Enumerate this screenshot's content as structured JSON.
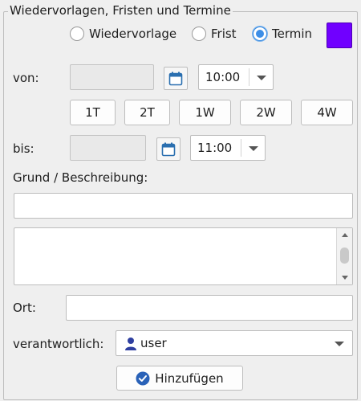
{
  "group": {
    "title": "Wiedervorlagen, Fristen und Termine"
  },
  "type_options": [
    {
      "label": "Wiedervorlage",
      "checked": false
    },
    {
      "label": "Frist",
      "checked": false
    },
    {
      "label": "Termin",
      "checked": true
    }
  ],
  "color": "#7000ff",
  "von": {
    "label": "von:",
    "date": "",
    "time": "10:00"
  },
  "quick_buttons": [
    "1T",
    "2T",
    "1W",
    "2W",
    "4W"
  ],
  "bis": {
    "label": "bis:",
    "date": "",
    "time": "11:00"
  },
  "reason": {
    "label": "Grund / Beschreibung:",
    "value": "",
    "description": ""
  },
  "ort": {
    "label": "Ort:",
    "value": ""
  },
  "responsible": {
    "label": "verantwortlich:",
    "value": "user"
  },
  "add_button": {
    "label": "Hinzufügen"
  }
}
